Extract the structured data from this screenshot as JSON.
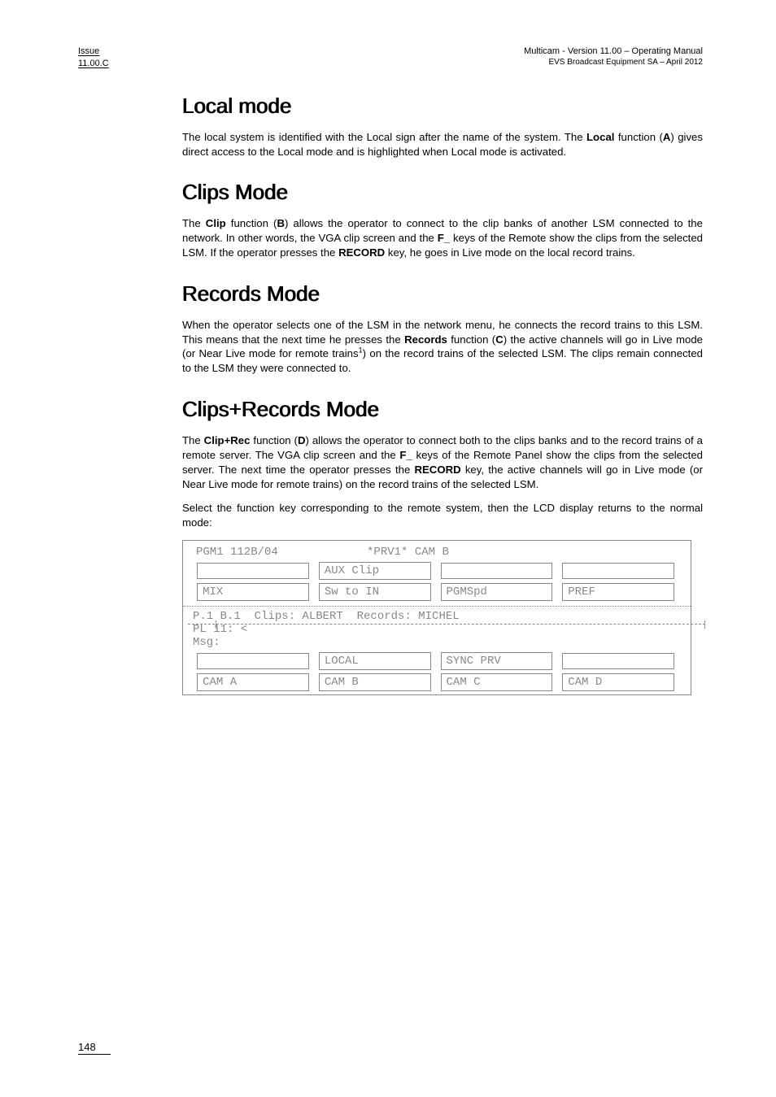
{
  "header": {
    "issue_line1": "Issue",
    "issue_line2": "11.00.C",
    "right_line1": "Multicam - Version 11.00 – Operating Manual",
    "right_line2": "EVS Broadcast Equipment SA – April 2012"
  },
  "sections": {
    "local": {
      "title": "Local mode",
      "p1_a": "The local system is identified with the Local sign after the name of the system. The ",
      "p1_b": "Local",
      "p1_c": " function (",
      "p1_d": "A",
      "p1_e": ") gives direct access to the Local mode and is highlighted when Local mode is activated."
    },
    "clips": {
      "title": "Clips Mode",
      "p1_a": "The ",
      "p1_b": "Clip",
      "p1_c": " function (",
      "p1_d": "B",
      "p1_e": ") allows the operator to connect to the clip banks of another LSM connected to the network. In other words, the VGA clip screen and the ",
      "p1_f": "F_",
      "p1_g": " keys of the Remote show the clips from the selected LSM. If the operator presses the ",
      "p1_h": "RECORD",
      "p1_i": " key, he goes in Live mode on the local record trains."
    },
    "records": {
      "title": "Records Mode",
      "p1_a": "When the operator selects one of the LSM in the network menu, he connects the record trains to this LSM. This means that the next time he presses the ",
      "p1_b": "Records",
      "p1_c": " function (",
      "p1_d": "C",
      "p1_e": ") the active channels will go in Live mode (or Near Live mode for remote trains",
      "p1_sup": "1",
      "p1_f": ") on the record trains of the selected LSM. The clips remain connected to the LSM they were connected to."
    },
    "cliprec": {
      "title": "Clips+Records Mode",
      "p1_a": "The ",
      "p1_b": "Clip+Rec",
      "p1_c": " function (",
      "p1_d": "D",
      "p1_e": ") allows the operator to connect both to the clips banks and to the record trains of a remote server. The VGA clip screen and the ",
      "p1_f": "F_",
      "p1_g": " keys of the Remote Panel show the clips from the selected server. The next time the operator presses the ",
      "p1_h": "RECORD",
      "p1_i": " key, the active channels will go in Live mode (or Near Live mode for remote trains) on the record trains of the selected LSM.",
      "p2": "Select the function key corresponding to the remote system, then the LCD display returns to the normal mode:"
    }
  },
  "lcd": {
    "top_head": "PGM1 112B/04             *PRV1* CAM B",
    "row1": [
      "",
      "AUX Clip",
      "",
      ""
    ],
    "row2": [
      "MIX",
      "Sw to IN",
      "PGMSpd",
      "PREF"
    ],
    "mid_line1": "P.1 B.1  Clips: ALBERT  Records: MICHEL",
    "mid_line2": "PL 11: <",
    "mid_line3": "Msg:",
    "row3": [
      "",
      "LOCAL",
      "SYNC PRV",
      ""
    ],
    "row4": [
      "CAM A",
      "CAM B",
      "CAM C",
      "CAM D"
    ]
  },
  "page_number": "148"
}
